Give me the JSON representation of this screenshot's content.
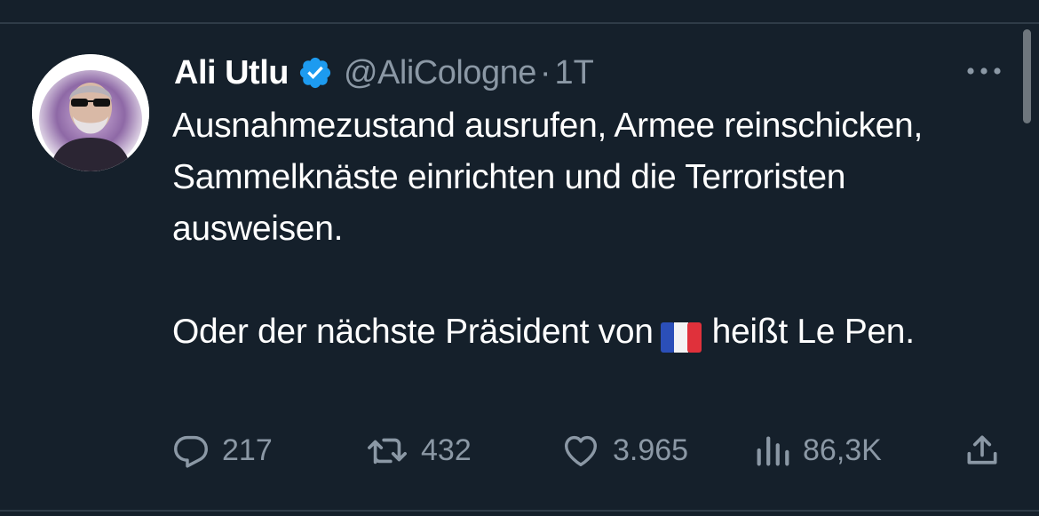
{
  "tweet": {
    "display_name": "Ali Utlu",
    "handle": "@AliCologne",
    "separator": "·",
    "time": "1T",
    "text_paragraph_1": "Ausnahmezustand ausrufen, Armee reinschicken, Sammelknäste einrichten und die Terroristen ausweisen.",
    "text_paragraph_2_before_flag": "Oder der nächste Präsident von",
    "flag_icon": "france-flag-icon",
    "text_paragraph_2_after_flag": "heißt Le Pen.",
    "verified": true
  },
  "actions": {
    "replies": "217",
    "retweets": "432",
    "likes": "3.965",
    "views": "86,3K"
  },
  "icons": {
    "avatar": "avatar",
    "verified": "verified-badge-icon",
    "more": "more-options-icon",
    "reply": "reply-icon",
    "retweet": "retweet-icon",
    "like": "heart-icon",
    "views": "views-chart-icon",
    "share": "share-icon"
  },
  "colors": {
    "background": "#15202b",
    "text_primary": "#ffffff",
    "text_secondary": "#8b98a5",
    "verified_blue": "#1d9bf0",
    "divider": "#2f3b47"
  }
}
